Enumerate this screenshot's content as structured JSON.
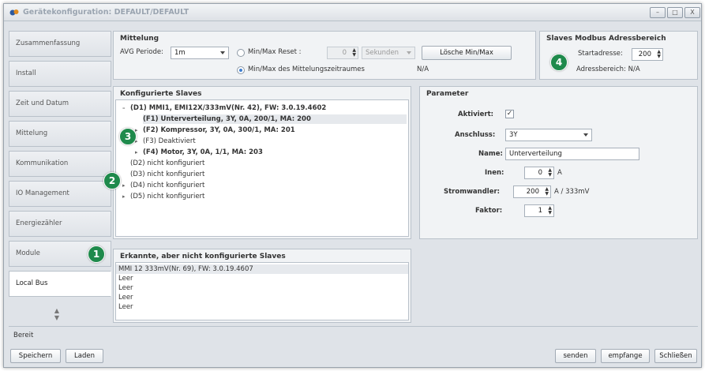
{
  "window": {
    "title": "Gerätekonfiguration: DEFAULT/DEFAULT",
    "controls": [
      "–",
      "□",
      "X"
    ]
  },
  "sidebar": {
    "items": [
      {
        "label": "Zusammenfassung"
      },
      {
        "label": "Install"
      },
      {
        "label": "Zeit und Datum"
      },
      {
        "label": "Mittelung"
      },
      {
        "label": "Kommunikation"
      },
      {
        "label": "IO Management"
      },
      {
        "label": "Energiezähler"
      },
      {
        "label": "Module"
      },
      {
        "label": "Local Bus"
      }
    ],
    "active_index": 8
  },
  "mittelung": {
    "title": "Mittelung",
    "avg_label": "AVG Periode:",
    "avg_value": "1m",
    "minmax_reset_label": "Min/Max Reset :",
    "reset_value": "0",
    "reset_unit": "Sekunden",
    "delete_button": "Lösche Min/Max",
    "mittelungszeitraum_label": "Min/Max des Mittelungszeitraumes",
    "na": "N/A"
  },
  "modbus": {
    "title": "Slaves Modbus Adressbereich",
    "start_label": "Startadresse:",
    "start_value": "200",
    "range_label": "Adressbereich: N/A"
  },
  "configured": {
    "title": "Konfigurierte Slaves",
    "rows": [
      {
        "text": "(D1) MMI1, EMI12X/333mV(Nr. 42), FW: 3.0.19.4602",
        "exp": "–"
      },
      {
        "text": "(F1) Unterverteilung, 3Y, 0A, 200/1, MA: 200",
        "exp": ""
      },
      {
        "text": "(F2) Kompressor, 3Y, 0A, 300/1, MA: 201",
        "exp": "▸"
      },
      {
        "text": "(F3) Deaktiviert",
        "exp": "▸"
      },
      {
        "text": "(F4) Motor, 3Y, 0A, 1/1, MA: 203",
        "exp": "▸"
      },
      {
        "text": "(D2) nicht konfiguriert",
        "exp": ""
      },
      {
        "text": "(D3) nicht konfiguriert",
        "exp": ""
      },
      {
        "text": "(D4) nicht konfiguriert",
        "exp": "▸"
      },
      {
        "text": "(D5) nicht konfiguriert",
        "exp": "▸"
      }
    ]
  },
  "parameter": {
    "title": "Parameter",
    "aktiviert_label": "Aktiviert:",
    "aktiviert_check": "✓",
    "anschluss_label": "Anschluss:",
    "anschluss_value": "3Y",
    "name_label": "Name:",
    "name_value": "Unterverteilung",
    "inen_label": "Inen:",
    "inen_value": "0",
    "inen_unit": "A",
    "strom_label": "Stromwandler:",
    "strom_value": "200",
    "strom_unit": "A / 333mV",
    "faktor_label": "Faktor:",
    "faktor_value": "1"
  },
  "detected": {
    "title": "Erkannte, aber nicht konfigurierte Slaves",
    "rows": [
      "MMI 12 333mV(Nr. 69), FW: 3.0.19.4607",
      "Leer",
      "Leer",
      "Leer",
      "Leer"
    ]
  },
  "badges": [
    "1",
    "2",
    "3",
    "4"
  ],
  "status": "Bereit",
  "footer": {
    "save": "Speichern",
    "load": "Laden",
    "send": "senden",
    "receive": "empfange",
    "close": "Schließen"
  },
  "colors": {
    "badge": "#1f8a4c",
    "accent": "#3f7fd0"
  }
}
